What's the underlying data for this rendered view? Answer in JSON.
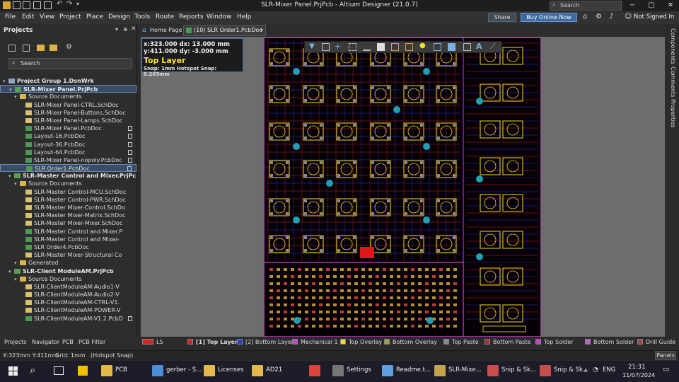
{
  "window": {
    "title": "SLR-Mixer Panel.PrjPcb - Altium Designer (21.0.7)",
    "search_placeholder": "Search",
    "minimize": "−",
    "maximize": "▢",
    "close": "✕"
  },
  "menu": [
    "File",
    "Edit",
    "View",
    "Project",
    "Place",
    "Design",
    "Tools",
    "Route",
    "Reports",
    "Window",
    "Help"
  ],
  "header_buttons": {
    "share": "Share",
    "buy": "Buy Online Now",
    "user": "Not Signed In"
  },
  "projects_panel": {
    "title": "Projects",
    "search_placeholder": "Search",
    "tree": [
      {
        "label": "Project Group 1.DsnWrk",
        "level": 0,
        "kind": "grp",
        "proj": true
      },
      {
        "label": "SLR-Mixer Panel.PrjPcb",
        "level": 1,
        "kind": "pjp",
        "proj": true,
        "selected_project": true
      },
      {
        "label": "Source Documents",
        "level": 2,
        "kind": "fold"
      },
      {
        "label": "SLR-Mixer Panel-CTRL.SchDoc",
        "level": 3,
        "kind": "sch"
      },
      {
        "label": "SLR-Mixer Panel-Buttons.SchDoc",
        "level": 3,
        "kind": "sch"
      },
      {
        "label": "SLR-Mixer Panel-Lamps.SchDoc",
        "level": 3,
        "kind": "sch"
      },
      {
        "label": "SLR-Mixer Panel.PcbDoc",
        "level": 3,
        "kind": "pcb",
        "file": true
      },
      {
        "label": "Layout-16.PcbDoc",
        "level": 3,
        "kind": "pcb",
        "file": true
      },
      {
        "label": "Layout-36.PcbDoc",
        "level": 3,
        "kind": "pcb",
        "file": true
      },
      {
        "label": "Layout-64.PcbDoc",
        "level": 3,
        "kind": "pcb",
        "file": true
      },
      {
        "label": "SLR-Mixer Panel-nopoly.PcbDoc",
        "level": 3,
        "kind": "pcb",
        "file": true
      },
      {
        "label": "SLR Order1.PcbDoc",
        "level": 3,
        "kind": "pcb",
        "file": true,
        "active": true
      },
      {
        "label": "SLR-Master Control and Mixer.PrjPc",
        "level": 1,
        "kind": "pjp",
        "proj": true
      },
      {
        "label": "Source Documents",
        "level": 2,
        "kind": "fold"
      },
      {
        "label": "SLR-Master Control-MCU.SchDoc",
        "level": 3,
        "kind": "sch"
      },
      {
        "label": "SLR-Master Control-PWR.SchDoc",
        "level": 3,
        "kind": "sch"
      },
      {
        "label": "SLR-Master Mixer-Control.SchDo",
        "level": 3,
        "kind": "sch"
      },
      {
        "label": "SLR-Master Mixer-Matrix.SchDoc",
        "level": 3,
        "kind": "sch"
      },
      {
        "label": "SLR-Master Mixer-Mixer.SchDoc",
        "level": 3,
        "kind": "sch"
      },
      {
        "label": "SLR-Master Control and Mixer.P",
        "level": 3,
        "kind": "pcb"
      },
      {
        "label": "SLR-Master Control and Mixer-",
        "level": 3,
        "kind": "pcb"
      },
      {
        "label": "SLR Order4.PcbDoc",
        "level": 3,
        "kind": "pcb"
      },
      {
        "label": "SLR-Master Mixer-Structural Co",
        "level": 3,
        "kind": "sch"
      },
      {
        "label": "Generated",
        "level": 2,
        "kind": "fold"
      },
      {
        "label": "SLR-Client ModuleAM.PrjPcb",
        "level": 1,
        "kind": "pjp",
        "proj": true
      },
      {
        "label": "Source Documents",
        "level": 2,
        "kind": "fold"
      },
      {
        "label": "SLR-ClientModuleAM-Audio1-V",
        "level": 3,
        "kind": "sch"
      },
      {
        "label": "SLR-ClientModuleAM-Audio2-V",
        "level": 3,
        "kind": "sch"
      },
      {
        "label": "SLR-ClientModuleAM-CTRL-V1.",
        "level": 3,
        "kind": "sch"
      },
      {
        "label": "SLR-ClientModuleAM-POWER-V",
        "level": 3,
        "kind": "sch"
      },
      {
        "label": "SLR-ClientModuleAM-V1.2.PcbD",
        "level": 3,
        "kind": "pcb",
        "file": true
      }
    ],
    "bottom_tabs": [
      "Projects",
      "Navigator",
      "PCB",
      "PCB Filter"
    ]
  },
  "doc_tabs": {
    "home": "Home Page",
    "active": "(10) SLR Order1.PcbDoc"
  },
  "hud": {
    "line1": "x:323.000   dx: 13.000  mm",
    "line2": "y:411.000   dy: -3.000  mm",
    "layer": "Top Layer",
    "snap": "Snap: 1mm Hotspot Snap: 0.203mm"
  },
  "right_tabs": [
    "Components",
    "Comments",
    "Properties"
  ],
  "layers": {
    "ls": "LS",
    "items": [
      {
        "label": "[1] Top Layer",
        "color": "#e02020",
        "active": true
      },
      {
        "label": "[2] Bottom Layer",
        "color": "#2040e0"
      },
      {
        "label": "Mechanical 1",
        "color": "#d040d0"
      },
      {
        "label": "Top Overlay",
        "color": "#f0e020"
      },
      {
        "label": "Bottom Overlay",
        "color": "#a0a040"
      },
      {
        "label": "Top Paste",
        "color": "#8a8a8a"
      },
      {
        "label": "Bottom Paste",
        "color": "#a03030"
      },
      {
        "label": "Top Solder",
        "color": "#c040c0"
      },
      {
        "label": "Bottom Solder",
        "color": "#c060d0"
      },
      {
        "label": "Drill Guide",
        "color": "#b04040"
      }
    ]
  },
  "status": {
    "coords": "X:323mm Y:411mm",
    "grid": "Grid: 1mm",
    "snap": "(Hotspot Snap)",
    "panels": "Panels"
  },
  "taskbar": {
    "apps": [
      {
        "label": "PCB",
        "color": "#e5b84a"
      },
      {
        "label": "gerber - S...",
        "color": "#4b8fd8"
      },
      {
        "label": "Licenses",
        "color": "#e5b84a"
      },
      {
        "label": "AD21",
        "color": "#e5b84a"
      },
      {
        "label": "",
        "color": "#db4437"
      },
      {
        "label": "Settings",
        "color": "#777"
      },
      {
        "label": "Readme.t...",
        "color": "#5fa0e0"
      },
      {
        "label": "SLR-Mixe...",
        "color": "#c4a34a"
      },
      {
        "label": "Snip & Sk...",
        "color": "#c94d4d"
      },
      {
        "label": "Snip & Sk...",
        "color": "#c94d4d"
      }
    ],
    "lang": "ENG",
    "time": "21:31",
    "date": "11/07/2024"
  }
}
